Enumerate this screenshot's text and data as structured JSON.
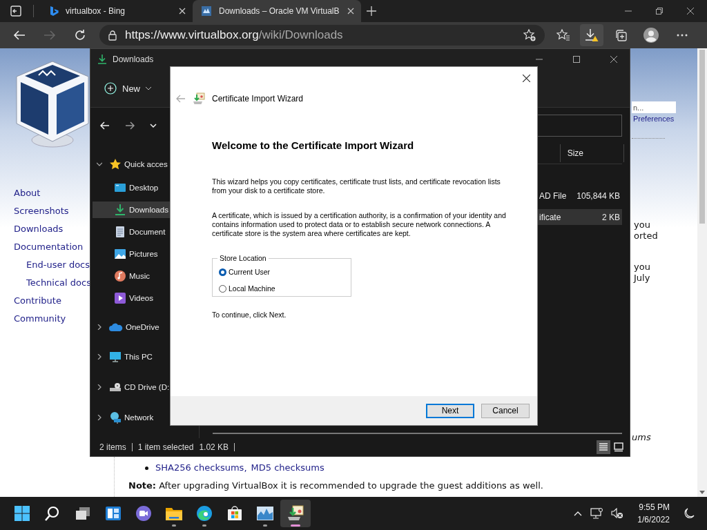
{
  "browser": {
    "tabs": [
      {
        "title": "virtualbox - Bing",
        "kind": "search",
        "selected": false
      },
      {
        "title": "Downloads – Oracle VM VirtualB",
        "kind": "site",
        "selected": true
      }
    ],
    "url": {
      "origin": "https://www.virtualbox.org",
      "path": "/wiki/Downloads"
    }
  },
  "site": {
    "nav": [
      {
        "label": "About"
      },
      {
        "label": "Screenshots"
      },
      {
        "label": "Downloads"
      },
      {
        "label": "Documentation",
        "children": [
          {
            "label": "End-user docs"
          },
          {
            "label": "Technical docs"
          }
        ]
      },
      {
        "label": "Contribute"
      },
      {
        "label": "Community"
      }
    ],
    "search": {
      "placeholder": "n..."
    },
    "preferences": "Preferences",
    "fragments": [
      {
        "lines": [
          "you",
          "orted"
        ]
      },
      {
        "lines": [
          "you",
          "July"
        ]
      }
    ],
    "cut_text": "ums",
    "checksums": {
      "links": [
        "SHA256 checksums",
        "MD5 checksums"
      ],
      "separator": ","
    },
    "note": "**Note:** After upgrading VirtualBox it is recommended to upgrade the guest additions as well."
  },
  "explorer": {
    "title": "Downloads",
    "new_label": "New",
    "sidebar": [
      {
        "label": "Quick acces",
        "kind": "star",
        "expanded": true,
        "selected": false,
        "children": [
          {
            "label": "Desktop",
            "kind": "desktop",
            "selected": false
          },
          {
            "label": "Downloads",
            "kind": "download",
            "selected": true
          },
          {
            "label": "Document",
            "kind": "document",
            "selected": false
          },
          {
            "label": "Pictures",
            "kind": "pictures",
            "selected": false
          },
          {
            "label": "Music",
            "kind": "music",
            "selected": false
          },
          {
            "label": "Videos",
            "kind": "videos",
            "selected": false
          }
        ]
      },
      {
        "label": "OneDrive",
        "kind": "cloud",
        "expanded": false,
        "selected": false
      },
      {
        "label": "This PC",
        "kind": "pc",
        "expanded": false,
        "selected": false
      },
      {
        "label": "CD Drive (D:",
        "kind": "drive",
        "expanded": false,
        "selected": false
      },
      {
        "label": "Network",
        "kind": "network",
        "expanded": false,
        "selected": false
      }
    ],
    "columns": [
      {
        "label": "Size"
      }
    ],
    "files": [
      {
        "type": "AD File",
        "size": "105,844 KB",
        "selected": false
      },
      {
        "type": "ificate",
        "size": "2 KB",
        "selected": true
      }
    ],
    "status": {
      "count": "2 items",
      "selection": "1 item selected",
      "size": "1.02 KB"
    },
    "views": [
      {
        "kind": "details",
        "selected": true
      },
      {
        "kind": "tiles",
        "selected": false
      }
    ]
  },
  "dialog": {
    "title": "Certificate Import Wizard",
    "heading": "Welcome to the Certificate Import Wizard",
    "paragraphs": [
      "This wizard helps you copy certificates, certificate trust lists, and certificate revocation lists from your disk to a certificate store.",
      "A certificate, which is issued by a certification authority, is a confirmation of your identity and contains information used to protect data or to establish secure network connections. A certificate store is the system area where certificates are kept."
    ],
    "store": {
      "label": "Store Location",
      "options": [
        {
          "label": "Current User",
          "selected": true
        },
        {
          "label": "Local Machine",
          "selected": false
        }
      ]
    },
    "hint": "To continue, click Next.",
    "buttons": [
      {
        "label": "Next",
        "default": true
      },
      {
        "label": "Cancel",
        "default": false
      }
    ]
  },
  "taskbar": {
    "apps": [
      {
        "kind": "start",
        "running": false,
        "selected": false
      },
      {
        "kind": "search",
        "running": false,
        "selected": false
      },
      {
        "kind": "taskview",
        "running": false,
        "selected": false
      },
      {
        "kind": "widgets",
        "running": false,
        "selected": false
      },
      {
        "kind": "chat",
        "running": false,
        "selected": false
      },
      {
        "kind": "folder",
        "running": true,
        "selected": false
      },
      {
        "kind": "browser",
        "running": true,
        "selected": false
      },
      {
        "kind": "store",
        "running": false,
        "selected": false
      },
      {
        "kind": "chart",
        "running": true,
        "selected": false
      },
      {
        "kind": "certificate",
        "running": true,
        "selected": true
      }
    ],
    "time": "9:55 PM",
    "date": "1/6/2022"
  }
}
